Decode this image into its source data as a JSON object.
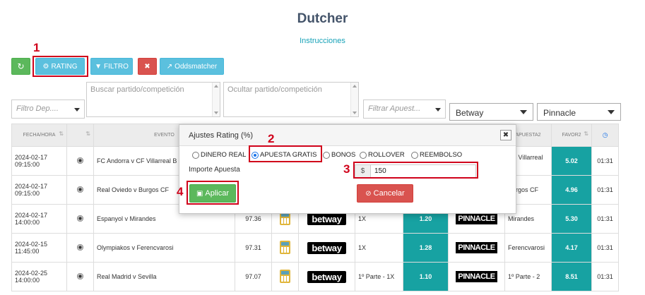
{
  "page": {
    "title": "Dutcher",
    "instructions_link": "Instrucciones"
  },
  "toolbar": {
    "refresh_icon": "refresh-icon",
    "rating_label": "RATING",
    "filtro_label": "FILTRO",
    "close_label": "✖",
    "oddsmatcher_label": "Oddsmatcher"
  },
  "filters": {
    "deporte_placeholder": "Filtro Dep....",
    "buscar_placeholder": "Buscar partido/competición",
    "ocultar_placeholder": "Ocultar partido/competición",
    "apuesta_placeholder": "Filtrar Apuest...",
    "bookie1": "Betway",
    "bookie2": "Pinnacle"
  },
  "table": {
    "headers": [
      "FECHA/HORA",
      "",
      "EVENTO",
      "",
      "",
      "",
      "",
      "",
      "",
      "APUESTA2",
      "FAVOR2",
      ""
    ],
    "rows": [
      {
        "date": "2024-02-17",
        "time": "09:15:00",
        "event": "FC Andorra v CF Villarreal B",
        "rating": "",
        "bet1": "",
        "odds1": "",
        "bet2": "CF Villarreal B",
        "odds2": "5.02",
        "clock": "01:31"
      },
      {
        "date": "2024-02-17",
        "time": "09:15:00",
        "event": "Real Oviedo v Burgos CF",
        "rating": "",
        "bet1": "",
        "odds1": "",
        "bet2": "Burgos CF",
        "odds2": "4.96",
        "clock": "01:31"
      },
      {
        "date": "2024-02-17",
        "time": "14:00:00",
        "event": "Espanyol v Mirandes",
        "rating": "97.36",
        "bet1": "1X",
        "odds1": "1.20",
        "bet2": "Mirandes",
        "odds2": "5.30",
        "clock": "01:31"
      },
      {
        "date": "2024-02-15",
        "time": "11:45:00",
        "event": "Olympiakos v Ferencvarosi",
        "rating": "97.31",
        "bet1": "1X",
        "odds1": "1.28",
        "bet2": "Ferencvarosi",
        "odds2": "4.17",
        "clock": "01:31"
      },
      {
        "date": "2024-02-25",
        "time": "14:00:00",
        "event": "Real Madrid v Sevilla",
        "rating": "97.07",
        "bet1": "1º Parte - 1X",
        "odds1": "1.10",
        "bet2": "1º Parte - 2",
        "odds2": "8.51",
        "clock": "01:31"
      }
    ],
    "betway_logo": "betway",
    "pinnacle_logo": "PINNACLE"
  },
  "modal": {
    "title": "Ajustes Rating (%)",
    "close": "✖",
    "options": [
      "DINERO REAL",
      "APUESTA GRATIS",
      "BONOS",
      "ROLLOVER",
      "REEMBOLSO"
    ],
    "selected": "APUESTA GRATIS",
    "importe_label": "Importe Apuesta",
    "currency": "$",
    "importe_value": "150",
    "apply_label": "Aplicar",
    "cancel_label": "Cancelar"
  },
  "annotations": [
    "1",
    "2",
    "3",
    "4"
  ],
  "colors": {
    "teal": "#17a2a2",
    "accent_red": "#d0021b",
    "info": "#5bc0de",
    "success": "#5cb85c",
    "danger": "#d9534f"
  }
}
